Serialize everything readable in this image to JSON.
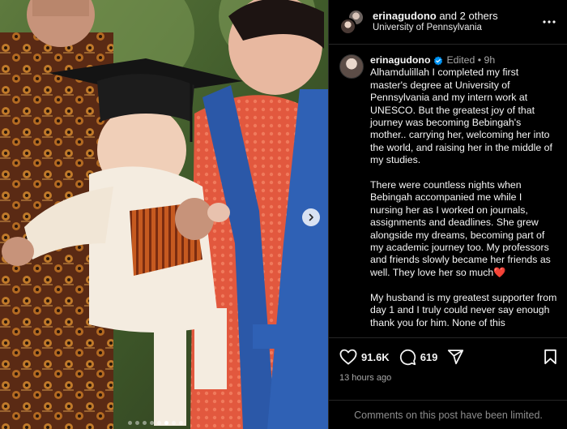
{
  "post": {
    "header": {
      "username": "erinagudono",
      "and_others": " and 2 others",
      "location": "University of Pennsylvania"
    },
    "caption": {
      "username": "erinagudono",
      "meta": "Edited • 9h",
      "paragraphs": [
        "Alhamdulillah I completed my first master's degree at University of Pennsylvania and my intern work at UNESCO. But the greatest joy of that journey was becoming Bebingah's mother.. carrying her, welcoming her into the world, and raising her in the middle of my studies.",
        "There were countless nights when Bebingah accompanied me while I nursing her as I worked on journals, assignments and deadlines. She grew alongside my dreams, becoming part of my academic journey too. My professors and friends slowly became her friends as well. They love her so much❤️",
        "My husband is my greatest supporter from day 1 and I truly could never say enough thank you for him. None of this"
      ]
    },
    "actions": {
      "likes": "91.6K",
      "comments": "619"
    },
    "timestamp": "13 hours ago",
    "comments_notice": "Comments on this post have been limited.",
    "carousel": {
      "total": 8,
      "active_index": 5
    }
  },
  "colors": {
    "background": "#000000",
    "divider": "#262626",
    "muted_text": "#a8a8a8",
    "verified_badge": "#0095f6"
  },
  "icons": [
    "more-icon",
    "verified-icon",
    "heart-icon",
    "comment-icon",
    "share-icon",
    "bookmark-icon",
    "chevron-right-icon"
  ]
}
